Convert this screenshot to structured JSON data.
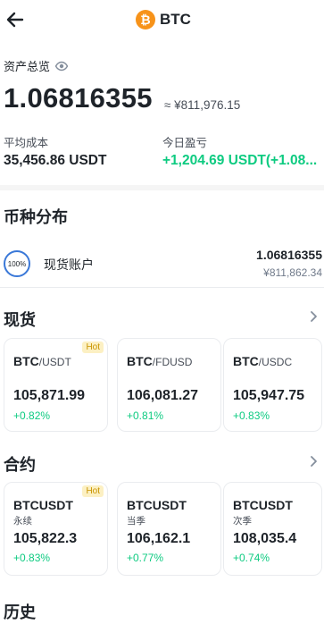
{
  "header": {
    "title": "BTC",
    "coin_symbol": "₿",
    "coin_color": "#f7931a",
    "back_icon": "arrow-left-icon"
  },
  "overview": {
    "label": "资产总览",
    "eye_icon": "eye-icon",
    "balance": "1.06816355",
    "balance_fiat": "≈ ¥811,976.15",
    "avg_cost_label": "平均成本",
    "avg_cost_value": "35,456.86 USDT",
    "pnl_label": "今日盈亏",
    "pnl_value": "+1,204.69 USDT(+1.08..."
  },
  "distribution": {
    "title": "币种分布",
    "accounts": [
      {
        "percent": "100%",
        "name": "现货账户",
        "amount": "1.06816355",
        "fiat": "¥811,862.34"
      }
    ]
  },
  "spot": {
    "title": "现货",
    "cards": [
      {
        "base": "BTC",
        "quote": "/USDT",
        "price": "105,871.99",
        "change": "+0.82%",
        "hot": "Hot"
      },
      {
        "base": "BTC",
        "quote": "/FDUSD",
        "price": "106,081.27",
        "change": "+0.81%",
        "hot": ""
      },
      {
        "base": "BTC",
        "quote": "/USDC",
        "price": "105,947.75",
        "change": "+0.83%",
        "hot": ""
      }
    ]
  },
  "futures": {
    "title": "合约",
    "cards": [
      {
        "symbol": "BTCUSDT",
        "type": "永续",
        "price": "105,822.3",
        "change": "+0.83%",
        "hot": "Hot"
      },
      {
        "symbol": "BTCUSDT",
        "type": "当季",
        "price": "106,162.1",
        "change": "+0.77%",
        "hot": ""
      },
      {
        "symbol": "BTCUSDT",
        "type": "次季",
        "price": "108,035.4",
        "change": "+0.74%",
        "hot": ""
      }
    ]
  },
  "history": {
    "title": "历史"
  },
  "colors": {
    "up": "#0ecb81",
    "ring": "#3a78d8",
    "hot_bg": "#fcf0c3",
    "hot_text": "#c99400"
  }
}
